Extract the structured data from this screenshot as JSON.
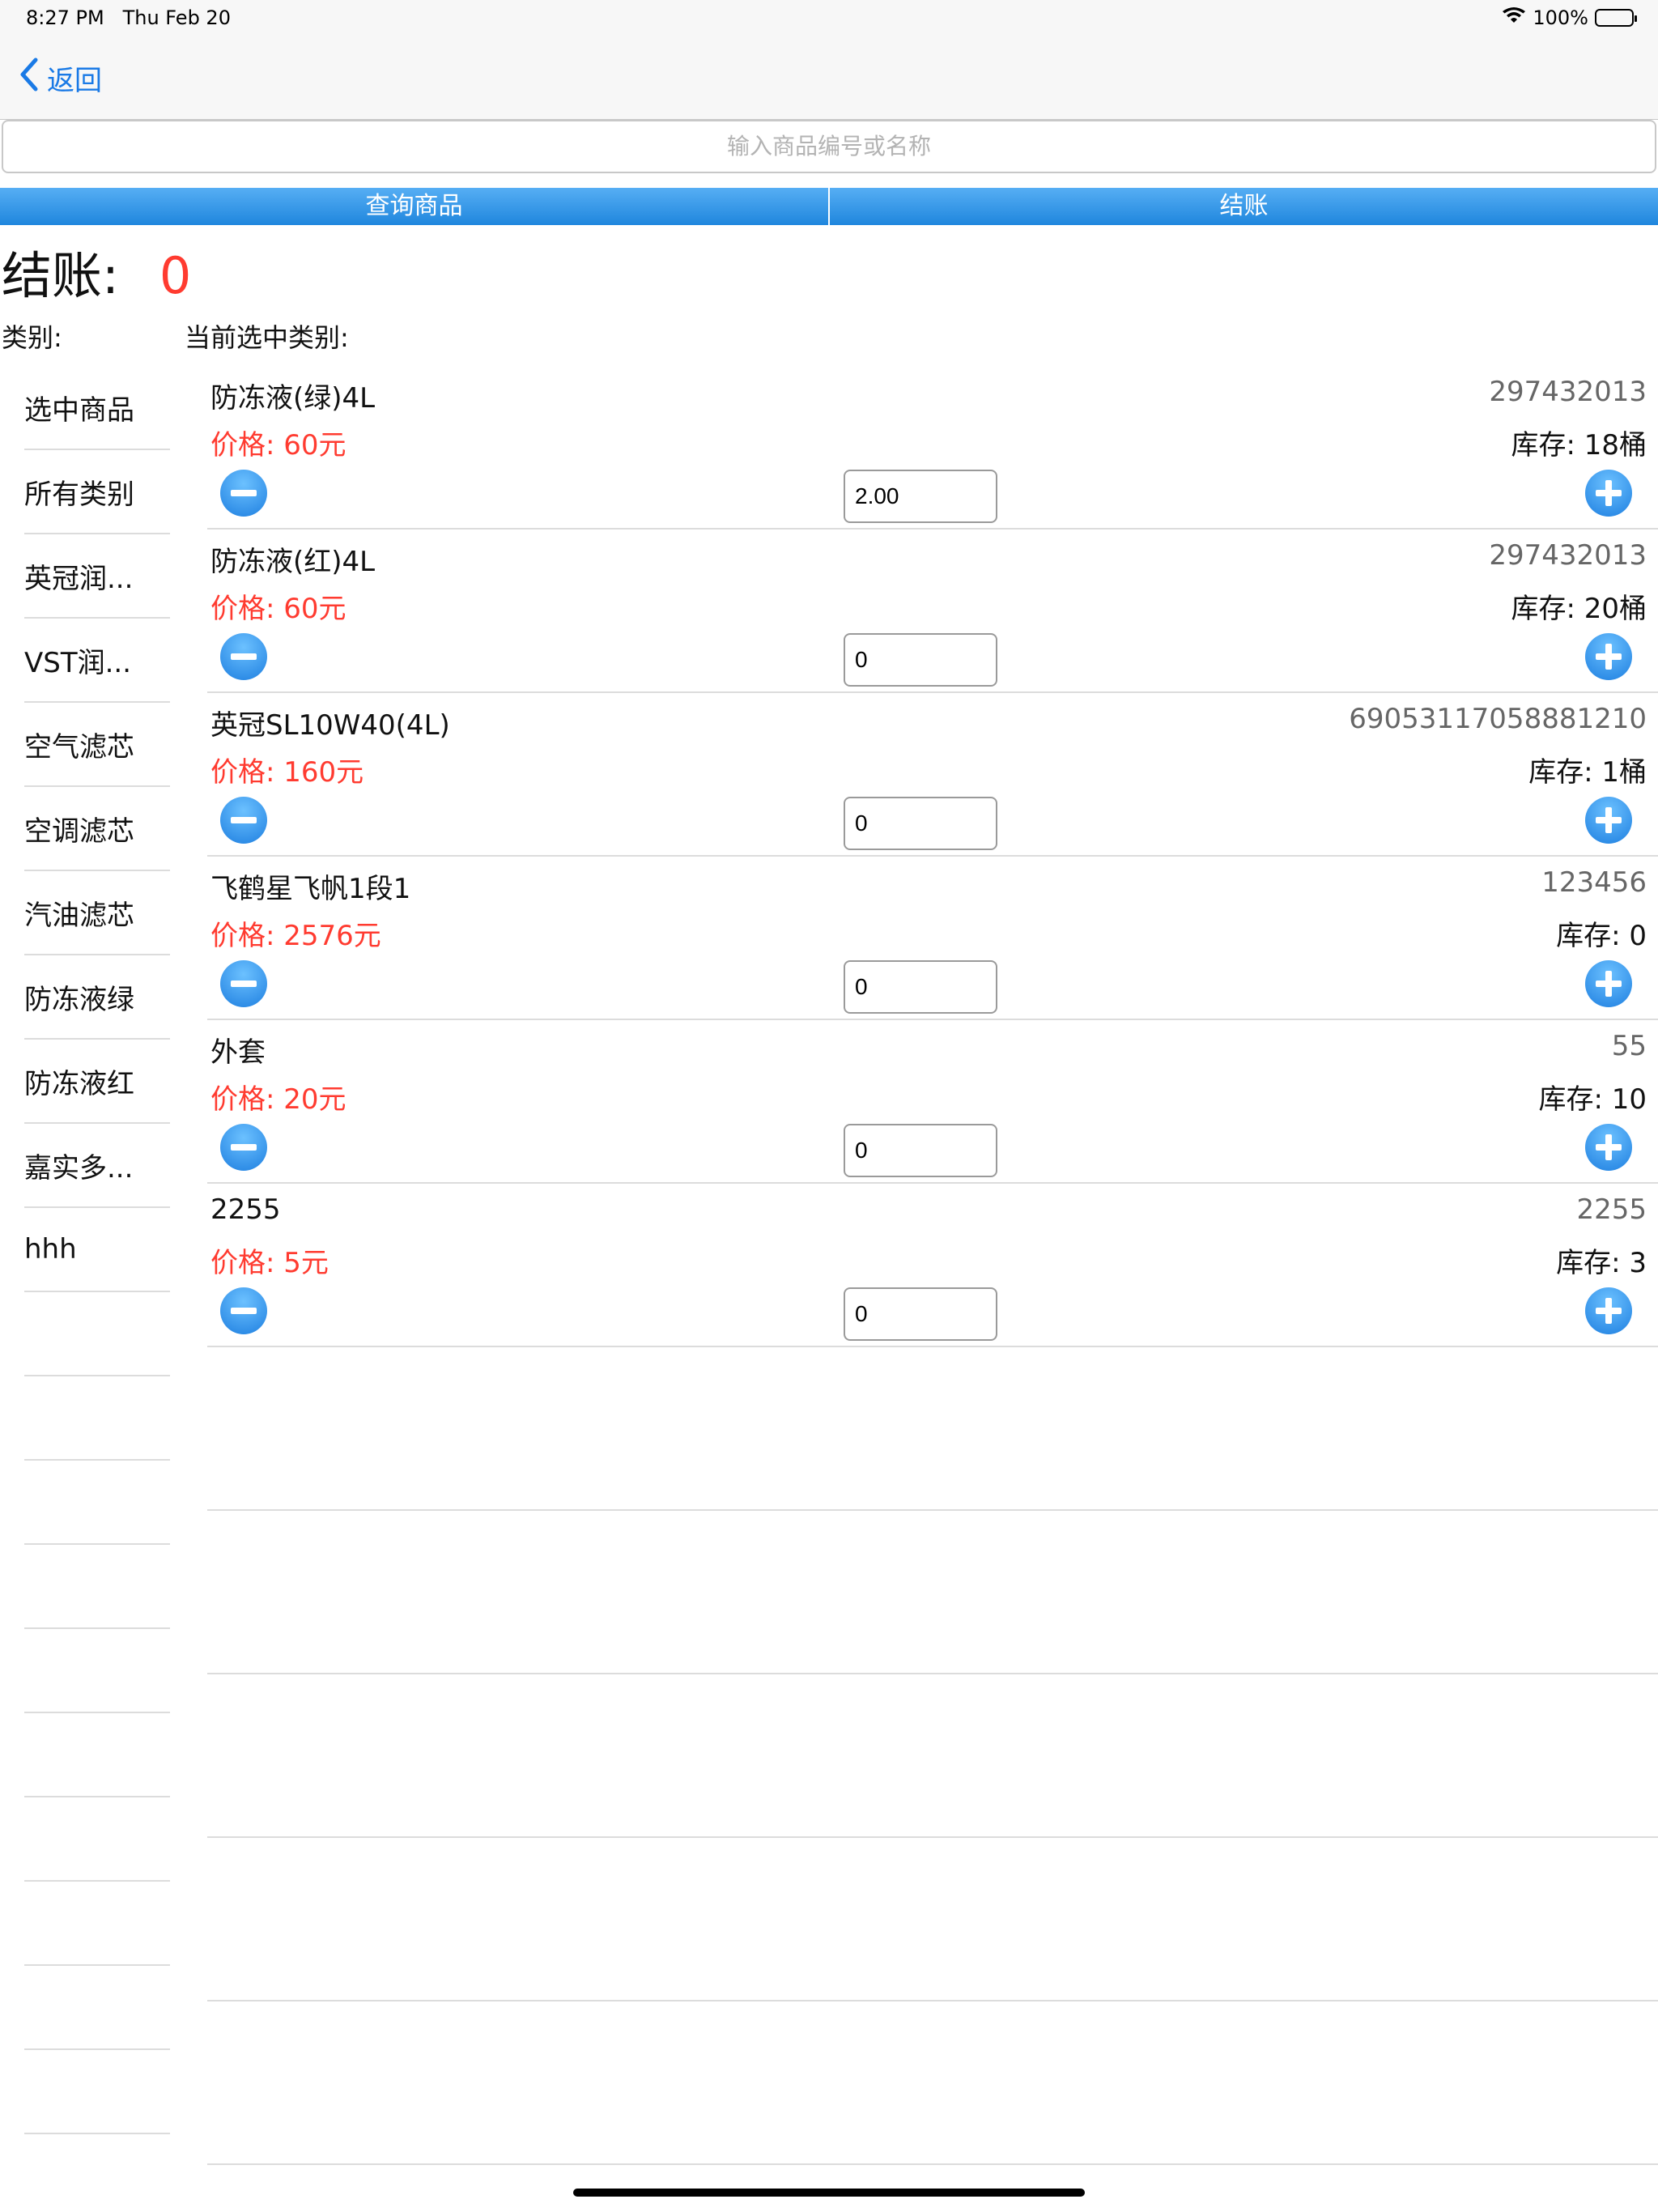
{
  "status": {
    "time": "8:27 PM",
    "date": "Thu Feb 20",
    "battery": "100%"
  },
  "nav": {
    "back_label": "返回"
  },
  "search": {
    "placeholder": "输入商品编号或名称"
  },
  "tabs": [
    {
      "label": "查询商品"
    },
    {
      "label": "结账"
    }
  ],
  "checkout": {
    "label": "结账:",
    "value": "0"
  },
  "categories_heading": "类别:",
  "current_category_heading": "当前选中类别:",
  "categories": [
    {
      "label": "选中商品"
    },
    {
      "label": "所有类别"
    },
    {
      "label": "英冠润..."
    },
    {
      "label": "VST润..."
    },
    {
      "label": "空气滤芯"
    },
    {
      "label": "空调滤芯"
    },
    {
      "label": "汽油滤芯"
    },
    {
      "label": "防冻液绿"
    },
    {
      "label": "防冻液红"
    },
    {
      "label": "嘉实多..."
    },
    {
      "label": "hhh"
    }
  ],
  "products": [
    {
      "name": "防冻液(绿)4L",
      "code": "297432013",
      "price": "价格: 60元",
      "stock": "库存: 18桶",
      "qty": "2.00"
    },
    {
      "name": "防冻液(红)4L",
      "code": "297432013",
      "price": "价格: 60元",
      "stock": "库存: 20桶",
      "qty": "0"
    },
    {
      "name": "英冠SL10W40(4L)",
      "code": "69053117058881210",
      "price": "价格: 160元",
      "stock": "库存: 1桶",
      "qty": "0"
    },
    {
      "name": "飞鹤星飞帆1段1",
      "code": "123456",
      "price": "价格: 2576元",
      "stock": "库存: 0",
      "qty": "0"
    },
    {
      "name": "外套",
      "code": "55",
      "price": "价格: 20元",
      "stock": "库存: 10",
      "qty": "0"
    },
    {
      "name": "2255",
      "code": "2255",
      "price": "价格: 5元",
      "stock": "库存: 3",
      "qty": "0"
    }
  ],
  "colors": {
    "accent": "#1a7ae6",
    "tab_blue": "#2d92e6",
    "price_red": "#ff3b30"
  }
}
